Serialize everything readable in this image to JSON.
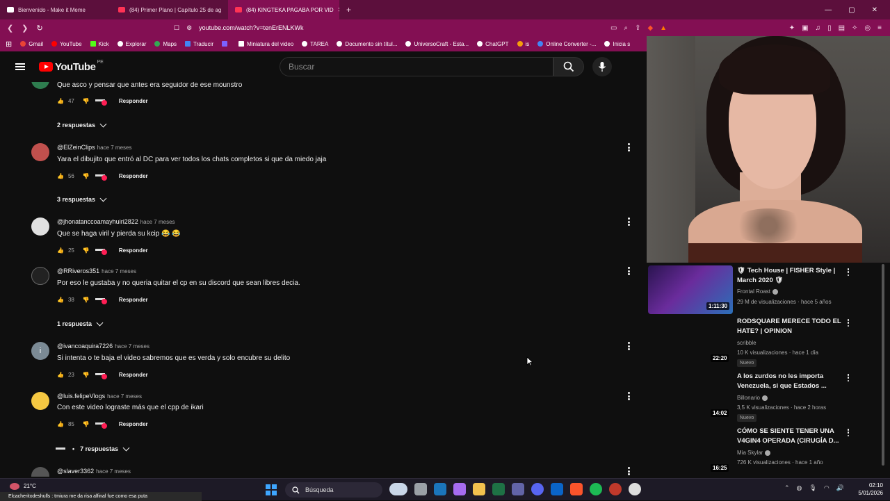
{
  "browser": {
    "tabs": [
      {
        "label": "Bienvenido - Make it Meme",
        "icon": "makeitmeme-favicon",
        "color": "#ffffff"
      },
      {
        "label": "(84) Primer Plano | Capítulo 25 de ag",
        "icon": "youtube-favicon",
        "color": "#ff3355"
      },
      {
        "label": "(84) KINGTEKA PAGABA POR VID",
        "icon": "youtube-favicon",
        "color": "#ff3355",
        "active": true
      }
    ],
    "url": "youtube.com/watch?v=tenErENLKWk",
    "bookmarks": [
      {
        "label": "Gmail",
        "color": "#ea4335"
      },
      {
        "label": "YouTube",
        "color": "#ff0000"
      },
      {
        "label": "Kick",
        "color": "#53fc18"
      },
      {
        "label": "Explorar",
        "color": "#ffffff"
      },
      {
        "label": "Maps",
        "color": "#34a853"
      },
      {
        "label": "Traducir",
        "color": "#4285f4"
      },
      {
        "label": "",
        "color": "#7b61ff"
      },
      {
        "label": "Miniatura del video",
        "color": "#ffffff"
      },
      {
        "label": "TAREA",
        "color": "#ffffff"
      },
      {
        "label": "Documento sin títul...",
        "color": "#ffffff"
      },
      {
        "label": "UniversoCraft - Esta...",
        "color": "#ffffff"
      },
      {
        "label": "ChatGPT",
        "color": "#ffffff"
      },
      {
        "label": "is",
        "color": "#f59e0b"
      },
      {
        "label": "Online Converter -...",
        "color": "#4285f4"
      },
      {
        "label": "Inicia s",
        "color": "#ffffff"
      }
    ]
  },
  "youtube": {
    "logo_text": "YouTube",
    "region": "PE",
    "search_placeholder": "Buscar"
  },
  "comments": [
    {
      "user": "",
      "time": "",
      "text": "Que asco y pensar que antes era seguidor de ese mounstro",
      "likes": "47",
      "reply_label": "Responder",
      "replies": "2 respuestas",
      "avatar_color": "#2e7d4f"
    },
    {
      "user": "@ElZeinClips",
      "time": "hace 7 meses",
      "text": "Yara el dibujito que entró al DC para ver todos los chats completos si que da miedo jaja",
      "likes": "56",
      "reply_label": "Responder",
      "replies": "3 respuestas",
      "avatar_color": "#c0504d"
    },
    {
      "user": "@jhonatanccoamayhuiri2822",
      "time": "hace 7 meses",
      "text": "Que se haga viril y pierda su kcip 😂 😂",
      "likes": "25",
      "reply_label": "Responder",
      "replies": "",
      "avatar_color": "#e0e0e0"
    },
    {
      "user": "@RRiveros351",
      "time": "hace 7 meses",
      "text": "Por eso le gustaba y no queria quitar el cp en su discord que sean libres decia.",
      "likes": "38",
      "reply_label": "Responder",
      "replies": "1 respuesta",
      "avatar_color": "#222222"
    },
    {
      "user": "@ivancoaquira7226",
      "time": "hace 7 meses",
      "text": "Si intenta o te baja el video sabremos que es verda y solo encubre su delito",
      "likes": "23",
      "reply_label": "Responder",
      "replies": "",
      "avatar_color": "#7b8a95"
    },
    {
      "user": "@luis.felipeVlogs",
      "time": "hace 7 meses",
      "text": "Con este video lograste más que el cpp de ikari",
      "likes": "85",
      "reply_label": "Responder",
      "replies": "7 respuestas",
      "avatar_color": "#f5c842"
    },
    {
      "user": "@slaver3362",
      "time": "hace 7 meses",
      "text": "",
      "likes": "",
      "reply_label": "",
      "replies": "",
      "avatar_color": "#555555"
    }
  ],
  "recommended": [
    {
      "title": "🛡 Tech House | FISHER Style | March 2020 🛡",
      "channel": "Frontal Roast",
      "verified": true,
      "meta": "29 M de visualizaciones · hace 5 años",
      "duration": "1:11:30",
      "badge": "",
      "thumb_color": "#3b1a6b"
    },
    {
      "title": "RODSQUARE MERECE TODO EL HATE? | OPINION",
      "channel": "scribble",
      "verified": false,
      "meta": "10 K visualizaciones · hace 1 día",
      "duration": "22:20",
      "badge": "Nuevo",
      "thumb_color": "#0f0f0f"
    },
    {
      "title": "A los zurdos no les importa Venezuela, si que Estados ...",
      "channel": "Billonario",
      "verified": true,
      "meta": "3,5 K visualizaciones · hace 2 horas",
      "duration": "14:02",
      "badge": "Nuevo",
      "thumb_color": "#0f0f0f"
    },
    {
      "title": "CÓMO SE SIENTE TENER UNA V4GIN4 OPERADA (CIRUGÍA D...",
      "channel": "Mia Skylar",
      "verified": true,
      "meta": "726 K visualizaciones · hace 1 año",
      "duration": "16:25",
      "badge": "",
      "thumb_color": "#0f0f0f"
    }
  ],
  "taskbar": {
    "weather": "21°C",
    "ticker": "Elcacheritodeshulls : tmiura me da risa alfinal fue como esa puta",
    "search_label": "Búsqueda",
    "time": "02:10",
    "date": "5/01/2026",
    "apps": [
      {
        "name": "cloud-icon",
        "color": "#c9d6e8"
      },
      {
        "name": "files-icon",
        "color": "#9aa0a6"
      },
      {
        "name": "steam-icon",
        "color": "#1b75bb"
      },
      {
        "name": "copilot-icon",
        "color": "#a66cf0"
      },
      {
        "name": "folder-icon",
        "color": "#f2c14e"
      },
      {
        "name": "excel-icon",
        "color": "#1e7145"
      },
      {
        "name": "teams-icon",
        "color": "#6264a7"
      },
      {
        "name": "discord-icon",
        "color": "#5865f2"
      },
      {
        "name": "mail-icon",
        "color": "#0a64c8"
      },
      {
        "name": "brave-icon",
        "color": "#fb542b"
      },
      {
        "name": "spotify-icon",
        "color": "#1db954"
      },
      {
        "name": "record-icon",
        "color": "#c0392b"
      },
      {
        "name": "obs-icon",
        "color": "#dddddd"
      }
    ]
  }
}
